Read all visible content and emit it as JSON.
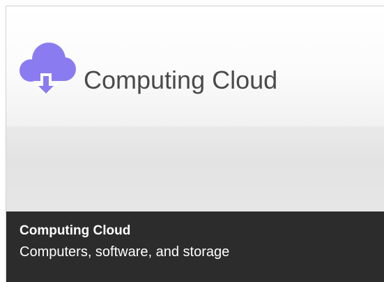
{
  "tile": {
    "title": "Computing Cloud",
    "icon": "cloud-download-icon",
    "icon_color": "#8a7cf0",
    "footer": {
      "title": "Computing Cloud",
      "description": "Computers, software, and storage"
    }
  }
}
